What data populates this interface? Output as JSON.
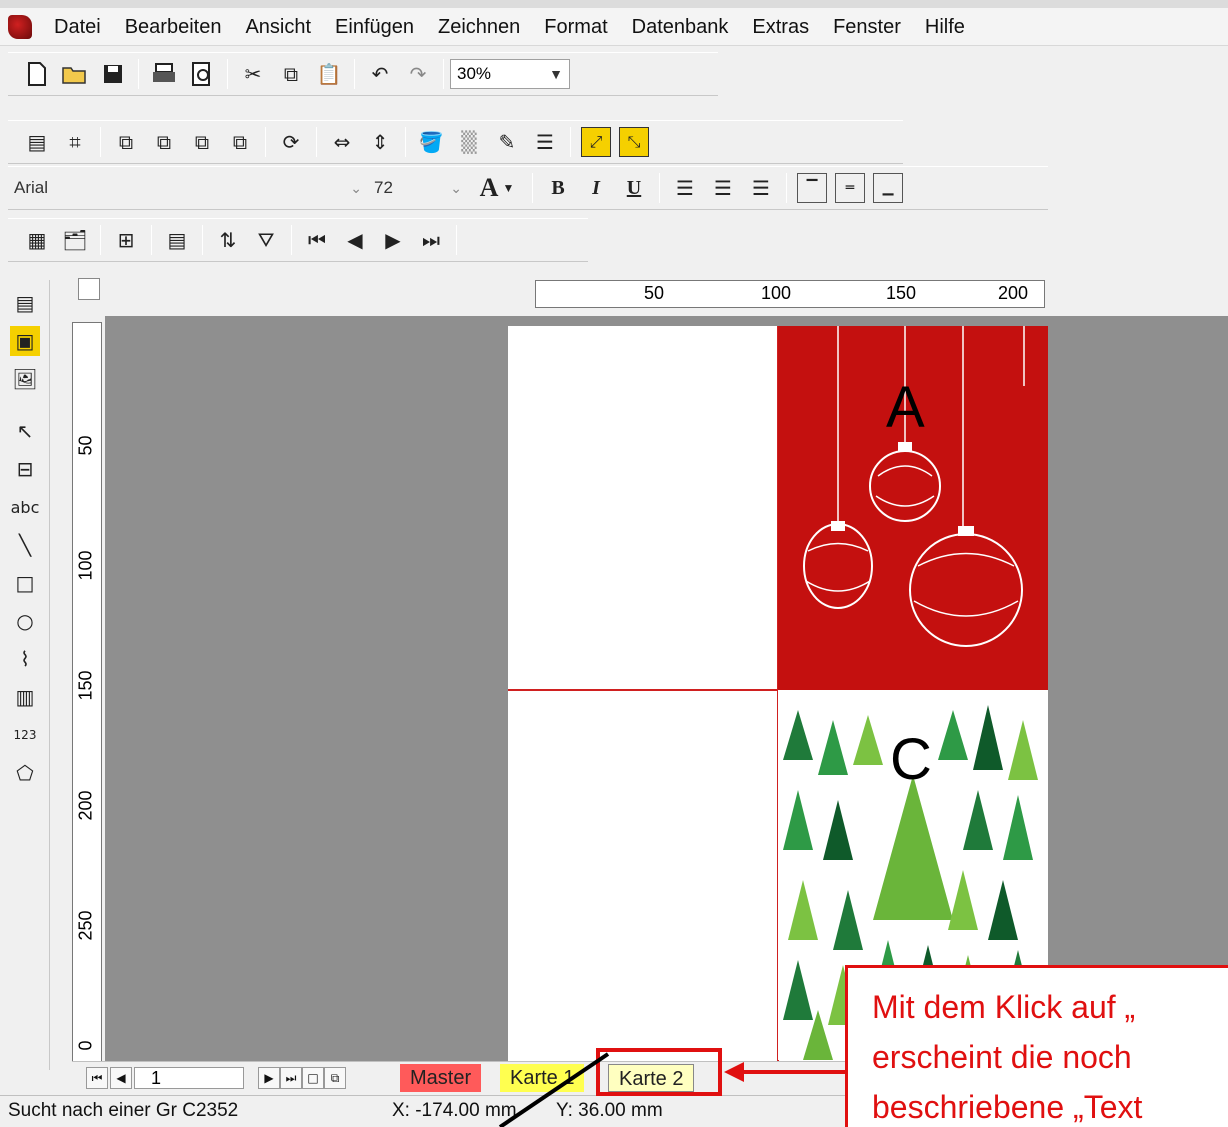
{
  "menu": [
    "Datei",
    "Bearbeiten",
    "Ansicht",
    "Einfügen",
    "Zeichnen",
    "Format",
    "Datenbank",
    "Extras",
    "Fenster",
    "Hilfe"
  ],
  "toolbar1": {
    "zoom": "30%"
  },
  "format_toolbar": {
    "font": "Arial",
    "size": "72",
    "bold": "B",
    "italic": "I",
    "underline": "U",
    "font_color_glyph": "A"
  },
  "nav_toolbar_icons": [
    "first-record-icon",
    "prev-record-icon",
    "next-record-icon",
    "last-record-icon"
  ],
  "hruler": {
    "ticks": [
      "50",
      "100",
      "150",
      "200"
    ]
  },
  "vruler": {
    "ticks": [
      "50",
      "100",
      "150",
      "200",
      "250",
      "0"
    ]
  },
  "cards": {
    "a_label": "A",
    "c_label": "C"
  },
  "tabbar": {
    "page_number": "1",
    "tabs": [
      "Master",
      "Karte 1",
      "Karte 2"
    ]
  },
  "status": {
    "message": "Sucht nach einer Gr C2352",
    "x": "X: -174.00 mm",
    "y": "Y: 36.00 mm"
  },
  "callout": {
    "line1": "Mit dem Klick auf „",
    "line2": "erscheint die noch",
    "line3": "beschriebene „Text"
  },
  "colors": {
    "accent": "#e01010",
    "card_red": "#c4100f",
    "master_tab": "#ff5a5a",
    "karte1_tab": "#ffff50",
    "karte2_tab": "#ffffc0"
  }
}
